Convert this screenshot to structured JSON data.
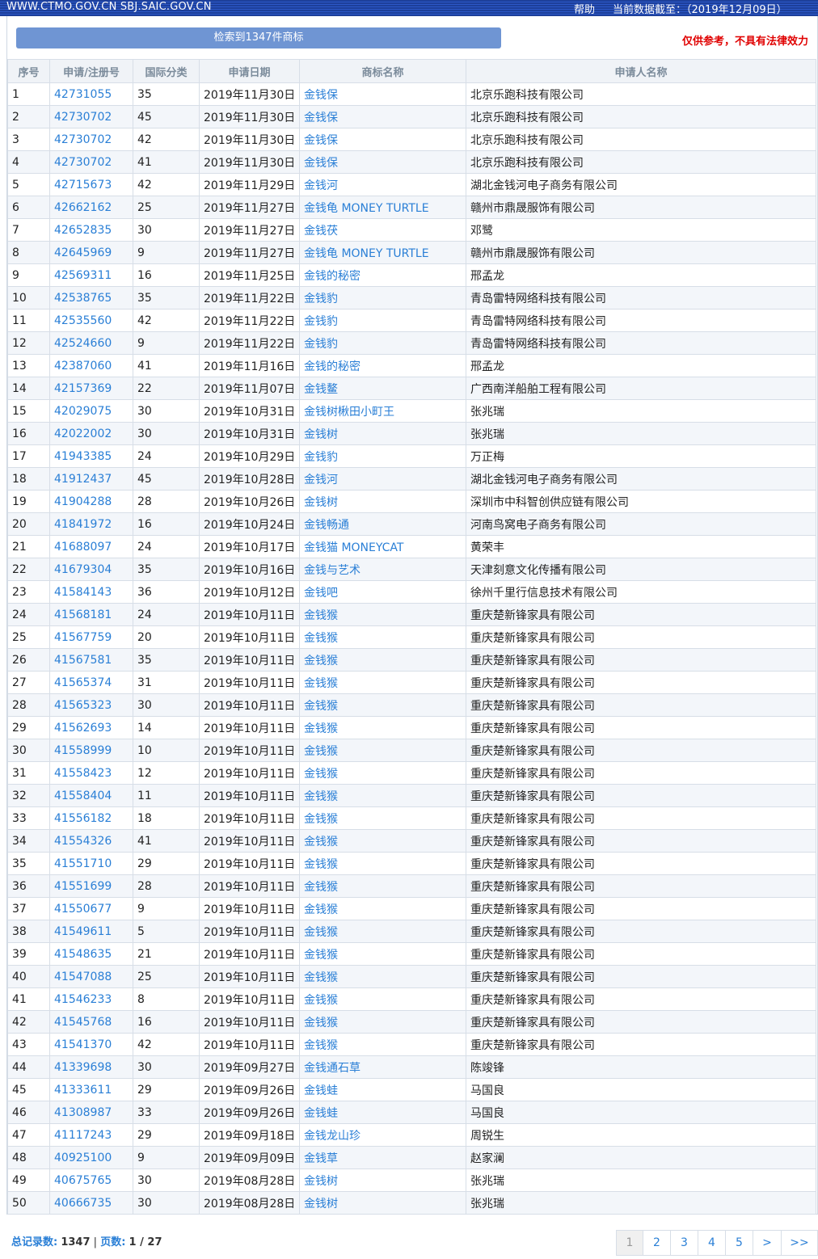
{
  "topbar": {
    "site": "WWW.CTMO.GOV.CN SBJ.SAIC.GOV.CN",
    "help": "帮助",
    "as_of": "当前数据截至：（2019年12月09日）"
  },
  "search_summary": "检索到1347件商标",
  "disclaimer": "仅供参考，不具有法律效力",
  "table": {
    "headers": [
      "序号",
      "申请/注册号",
      "国际分类",
      "申请日期",
      "商标名称",
      "申请人名称"
    ],
    "rows": [
      [
        "1",
        "42731055",
        "35",
        "2019年11月30日",
        "金钱保",
        "北京乐跑科技有限公司"
      ],
      [
        "2",
        "42730702",
        "45",
        "2019年11月30日",
        "金钱保",
        "北京乐跑科技有限公司"
      ],
      [
        "3",
        "42730702",
        "42",
        "2019年11月30日",
        "金钱保",
        "北京乐跑科技有限公司"
      ],
      [
        "4",
        "42730702",
        "41",
        "2019年11月30日",
        "金钱保",
        "北京乐跑科技有限公司"
      ],
      [
        "5",
        "42715673",
        "42",
        "2019年11月29日",
        "金钱河",
        "湖北金钱河电子商务有限公司"
      ],
      [
        "6",
        "42662162",
        "25",
        "2019年11月27日",
        "金钱龟 MONEY TURTLE",
        "赣州市鼎晟服饰有限公司"
      ],
      [
        "7",
        "42652835",
        "30",
        "2019年11月27日",
        "金钱茯",
        "邓鹭"
      ],
      [
        "8",
        "42645969",
        "9",
        "2019年11月27日",
        "金钱龟 MONEY TURTLE",
        "赣州市鼎晟服饰有限公司"
      ],
      [
        "9",
        "42569311",
        "16",
        "2019年11月25日",
        "金钱的秘密",
        "邢孟龙"
      ],
      [
        "10",
        "42538765",
        "35",
        "2019年11月22日",
        "金钱豹",
        "青岛雷特网络科技有限公司"
      ],
      [
        "11",
        "42535560",
        "42",
        "2019年11月22日",
        "金钱豹",
        "青岛雷特网络科技有限公司"
      ],
      [
        "12",
        "42524660",
        "9",
        "2019年11月22日",
        "金钱豹",
        "青岛雷特网络科技有限公司"
      ],
      [
        "13",
        "42387060",
        "41",
        "2019年11月16日",
        "金钱的秘密",
        "邢孟龙"
      ],
      [
        "14",
        "42157369",
        "22",
        "2019年11月07日",
        "金钱鳌",
        "广西南洋船舶工程有限公司"
      ],
      [
        "15",
        "42029075",
        "30",
        "2019年10月31日",
        "金钱树楸田小町王",
        "张兆瑞"
      ],
      [
        "16",
        "42022002",
        "30",
        "2019年10月31日",
        "金钱树",
        "张兆瑞"
      ],
      [
        "17",
        "41943385",
        "24",
        "2019年10月29日",
        "金钱豹",
        "万正梅"
      ],
      [
        "18",
        "41912437",
        "45",
        "2019年10月28日",
        "金钱河",
        "湖北金钱河电子商务有限公司"
      ],
      [
        "19",
        "41904288",
        "28",
        "2019年10月26日",
        "金钱树",
        "深圳市中科智创供应链有限公司"
      ],
      [
        "20",
        "41841972",
        "16",
        "2019年10月24日",
        "金钱畅通",
        "河南鸟窝电子商务有限公司"
      ],
      [
        "21",
        "41688097",
        "24",
        "2019年10月17日",
        "金钱猫 MONEYCAT",
        "黄荣丰"
      ],
      [
        "22",
        "41679304",
        "35",
        "2019年10月16日",
        "金钱与艺术",
        "天津刻意文化传播有限公司"
      ],
      [
        "23",
        "41584143",
        "36",
        "2019年10月12日",
        "金钱吧",
        "徐州千里行信息技术有限公司"
      ],
      [
        "24",
        "41568181",
        "24",
        "2019年10月11日",
        "金钱猴",
        "重庆楚新锋家具有限公司"
      ],
      [
        "25",
        "41567759",
        "20",
        "2019年10月11日",
        "金钱猴",
        "重庆楚新锋家具有限公司"
      ],
      [
        "26",
        "41567581",
        "35",
        "2019年10月11日",
        "金钱猴",
        "重庆楚新锋家具有限公司"
      ],
      [
        "27",
        "41565374",
        "31",
        "2019年10月11日",
        "金钱猴",
        "重庆楚新锋家具有限公司"
      ],
      [
        "28",
        "41565323",
        "30",
        "2019年10月11日",
        "金钱猴",
        "重庆楚新锋家具有限公司"
      ],
      [
        "29",
        "41562693",
        "14",
        "2019年10月11日",
        "金钱猴",
        "重庆楚新锋家具有限公司"
      ],
      [
        "30",
        "41558999",
        "10",
        "2019年10月11日",
        "金钱猴",
        "重庆楚新锋家具有限公司"
      ],
      [
        "31",
        "41558423",
        "12",
        "2019年10月11日",
        "金钱猴",
        "重庆楚新锋家具有限公司"
      ],
      [
        "32",
        "41558404",
        "11",
        "2019年10月11日",
        "金钱猴",
        "重庆楚新锋家具有限公司"
      ],
      [
        "33",
        "41556182",
        "18",
        "2019年10月11日",
        "金钱猴",
        "重庆楚新锋家具有限公司"
      ],
      [
        "34",
        "41554326",
        "41",
        "2019年10月11日",
        "金钱猴",
        "重庆楚新锋家具有限公司"
      ],
      [
        "35",
        "41551710",
        "29",
        "2019年10月11日",
        "金钱猴",
        "重庆楚新锋家具有限公司"
      ],
      [
        "36",
        "41551699",
        "28",
        "2019年10月11日",
        "金钱猴",
        "重庆楚新锋家具有限公司"
      ],
      [
        "37",
        "41550677",
        "9",
        "2019年10月11日",
        "金钱猴",
        "重庆楚新锋家具有限公司"
      ],
      [
        "38",
        "41549611",
        "5",
        "2019年10月11日",
        "金钱猴",
        "重庆楚新锋家具有限公司"
      ],
      [
        "39",
        "41548635",
        "21",
        "2019年10月11日",
        "金钱猴",
        "重庆楚新锋家具有限公司"
      ],
      [
        "40",
        "41547088",
        "25",
        "2019年10月11日",
        "金钱猴",
        "重庆楚新锋家具有限公司"
      ],
      [
        "41",
        "41546233",
        "8",
        "2019年10月11日",
        "金钱猴",
        "重庆楚新锋家具有限公司"
      ],
      [
        "42",
        "41545768",
        "16",
        "2019年10月11日",
        "金钱猴",
        "重庆楚新锋家具有限公司"
      ],
      [
        "43",
        "41541370",
        "42",
        "2019年10月11日",
        "金钱猴",
        "重庆楚新锋家具有限公司"
      ],
      [
        "44",
        "41339698",
        "30",
        "2019年09月27日",
        "金钱通石草",
        "陈竣锋"
      ],
      [
        "45",
        "41333611",
        "29",
        "2019年09月26日",
        "金钱蛙",
        "马国良"
      ],
      [
        "46",
        "41308987",
        "33",
        "2019年09月26日",
        "金钱蛙",
        "马国良"
      ],
      [
        "47",
        "41117243",
        "29",
        "2019年09月18日",
        "金钱龙山珍",
        "周锐生"
      ],
      [
        "48",
        "40925100",
        "9",
        "2019年09月09日",
        "金钱草",
        "赵家澜"
      ],
      [
        "49",
        "40675765",
        "30",
        "2019年08月28日",
        "金钱树",
        "张兆瑞"
      ],
      [
        "50",
        "40666735",
        "30",
        "2019年08月28日",
        "金钱树",
        "张兆瑞"
      ]
    ]
  },
  "footer": {
    "total_label": "总记录数:",
    "total_value": "1347",
    "separator": "|",
    "pages_label": "页数:",
    "pages_value": "1 / 27"
  },
  "pager": [
    "1",
    "2",
    "3",
    "4",
    "5",
    ">",
    ">>"
  ],
  "colors": {
    "link": "#2a7fd6",
    "disclaimer": "#e00000",
    "search_bar": "#6f95d3",
    "topbar": "#1d3f9a"
  }
}
